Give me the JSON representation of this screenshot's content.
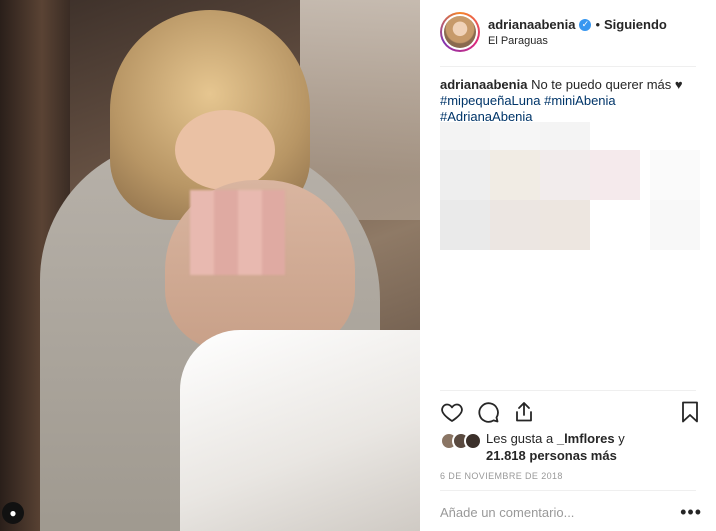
{
  "post": {
    "username": "adrianaabenia",
    "follow_status": "Siguiendo",
    "separator_dot": "•",
    "location": "El Paraguas",
    "verified_mark": "✓",
    "caption_user": "adrianaabenia",
    "caption_text": "No te puedo querer más ♥",
    "hashtags": [
      "#mipequeñaLuna",
      "#miniAbenia",
      "#AdrianaAbenia"
    ],
    "likes_prefix": "Les gusta a",
    "likes_user": "_lmflores",
    "likes_connector": "y",
    "likes_count": "21.818 personas más",
    "date": "6 DE NOVIEMBRE DE 2018",
    "comment_placeholder": "Añade un comentario...",
    "more_label": "•••"
  },
  "icons": {
    "like": "heart-icon",
    "comment": "comment-icon",
    "share": "share-icon",
    "save": "bookmark-icon",
    "profile": "user-icon"
  },
  "colors": {
    "hashtag": "#003569",
    "verified": "#3897f0",
    "muted": "#999999"
  }
}
